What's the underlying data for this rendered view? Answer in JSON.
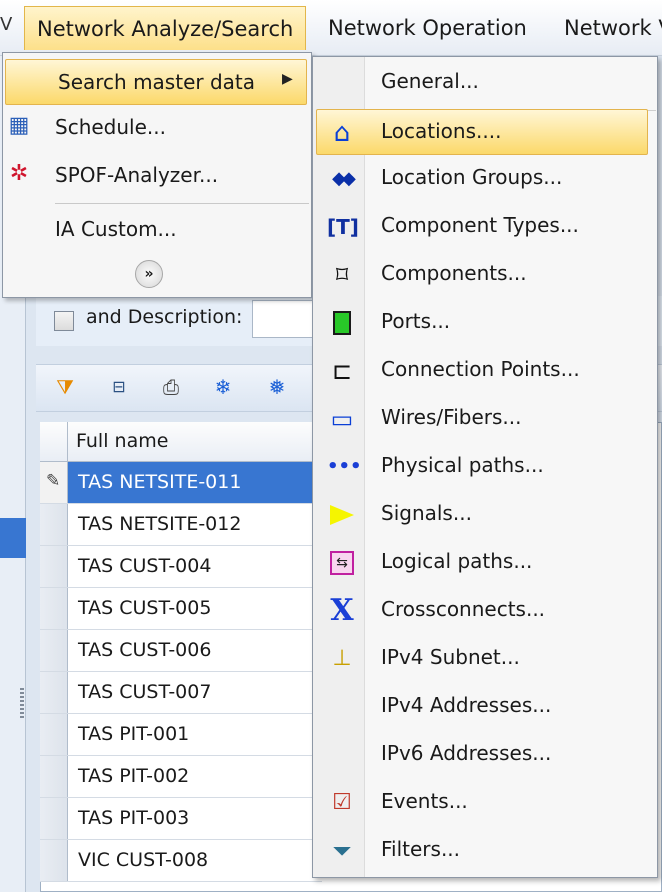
{
  "menubar": {
    "edge_glyph": "V",
    "items": [
      "Network Analyze/Search",
      "Network Operation",
      "Network V"
    ]
  },
  "filter": {
    "checkbox_label": "and Description:"
  },
  "toolbar": {
    "icons": [
      "filter-icon",
      "columns-icon",
      "print-icon",
      "snowflake-icon",
      "snowflake-tree-icon"
    ]
  },
  "grid": {
    "header": "Full name",
    "rows": [
      "TAS NETSITE-011",
      "TAS NETSITE-012",
      "TAS CUST-004",
      "TAS CUST-005",
      "TAS CUST-006",
      "TAS CUST-007",
      "TAS PIT-001",
      "TAS PIT-002",
      "TAS PIT-003",
      "VIC CUST-008"
    ],
    "selected_row": "TAS NETSITE-011"
  },
  "menu1": {
    "items": [
      {
        "label": "Search master data",
        "icon": "",
        "highlighted": true,
        "submenu": true
      },
      {
        "label": "Schedule...",
        "icon": "calendar-icon"
      },
      {
        "label": "SPOF-Analyzer...",
        "icon": "spof-icon"
      },
      {
        "label": "IA Custom...",
        "icon": ""
      }
    ],
    "expand_label": "»"
  },
  "menu2": {
    "items": [
      {
        "label": "General...",
        "icon": ""
      },
      {
        "label": "Locations....",
        "icon": "house-icon",
        "highlighted": true
      },
      {
        "label": "Location Groups...",
        "icon": "location-groups-icon"
      },
      {
        "label": "Component Types...",
        "icon": "component-type-icon"
      },
      {
        "label": "Components...",
        "icon": "component-icon"
      },
      {
        "label": "Ports...",
        "icon": "port-icon"
      },
      {
        "label": "Connection Points...",
        "icon": "connection-point-icon"
      },
      {
        "label": "Wires/Fibers...",
        "icon": "wire-icon"
      },
      {
        "label": "Physical paths...",
        "icon": "physical-path-icon"
      },
      {
        "label": "Signals...",
        "icon": "signal-flag-icon"
      },
      {
        "label": "Logical paths...",
        "icon": "logical-path-icon"
      },
      {
        "label": "Crossconnects...",
        "icon": "crossconnect-icon"
      },
      {
        "label": "IPv4 Subnet...",
        "icon": "subnet-icon"
      },
      {
        "label": "IPv4 Addresses...",
        "icon": ""
      },
      {
        "label": "IPv6 Addresses...",
        "icon": ""
      },
      {
        "label": "Events...",
        "icon": "events-icon"
      },
      {
        "label": "Filters...",
        "icon": "filter-icon"
      }
    ]
  },
  "colors": {
    "highlight_top": "#fff6d6",
    "highlight_bottom": "#fbd96a",
    "selection": "#3876d1"
  }
}
